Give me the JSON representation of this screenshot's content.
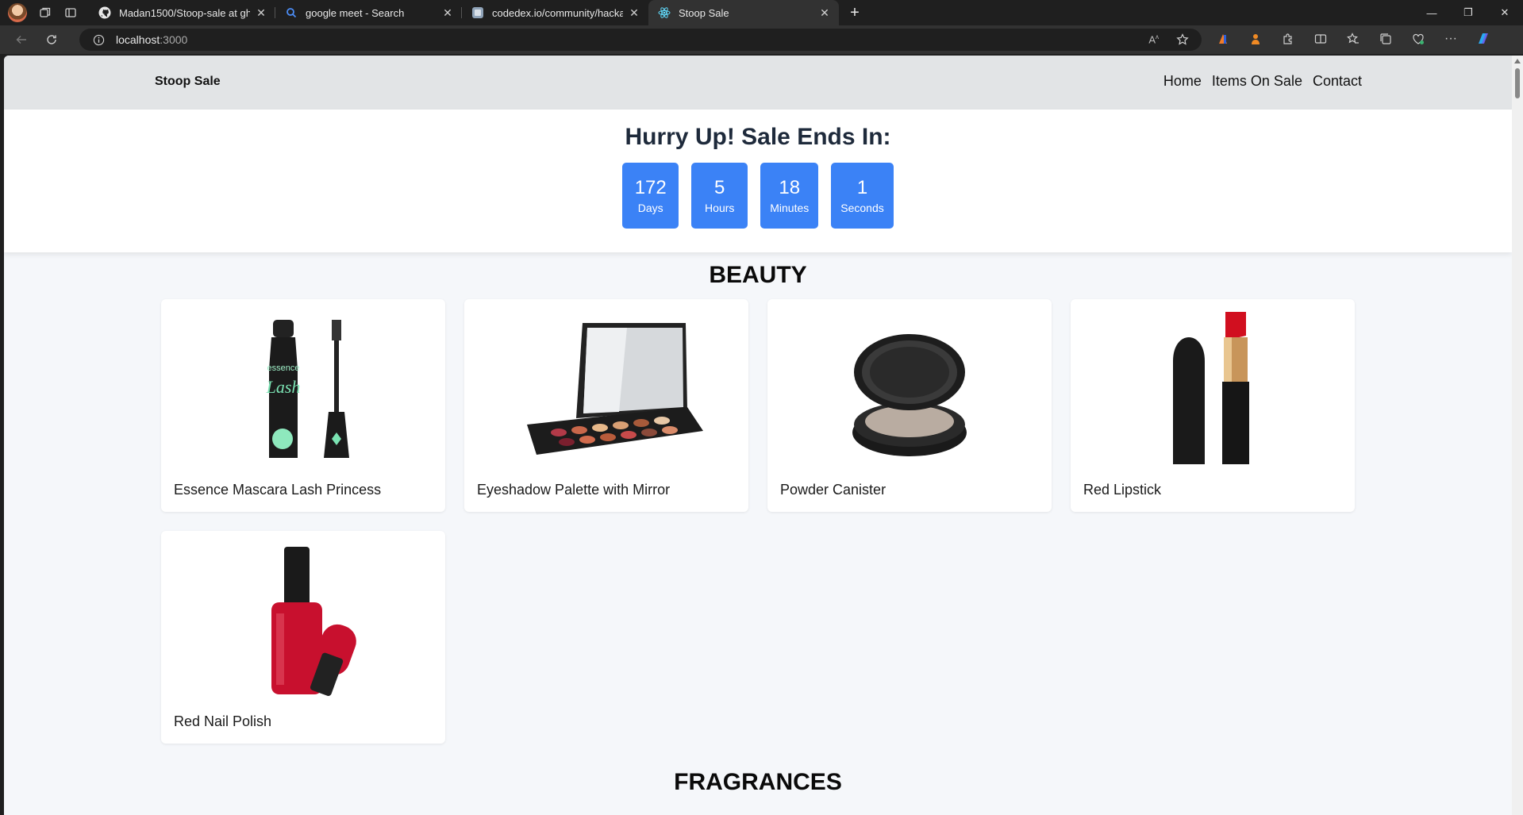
{
  "browser": {
    "tabs": [
      {
        "title": "Madan1500/Stoop-sale at gh-pa",
        "icon": "github-icon"
      },
      {
        "title": "google meet - Search",
        "icon": "search-icon"
      },
      {
        "title": "codedex.io/community/hackatho",
        "icon": "codedex-icon"
      },
      {
        "title": "Stoop Sale",
        "icon": "react-icon",
        "active": true
      }
    ],
    "address": {
      "host": "localhost",
      "port": ":3000"
    }
  },
  "site": {
    "brand": "Stoop Sale",
    "nav": [
      "Home",
      "Items On Sale",
      "Contact"
    ]
  },
  "countdown": {
    "heading": "Hurry Up! Sale Ends In:",
    "units": [
      {
        "value": "172",
        "label": "Days"
      },
      {
        "value": "5",
        "label": "Hours"
      },
      {
        "value": "18",
        "label": "Minutes"
      },
      {
        "value": "1",
        "label": "Seconds"
      }
    ]
  },
  "sections": [
    {
      "title": "BEAUTY",
      "items": [
        {
          "name": "Essence Mascara Lash Princess"
        },
        {
          "name": "Eyeshadow Palette with Mirror"
        },
        {
          "name": "Powder Canister"
        },
        {
          "name": "Red Lipstick"
        },
        {
          "name": "Red Nail Polish"
        }
      ]
    },
    {
      "title": "FRAGRANCES",
      "items": []
    }
  ],
  "colors": {
    "accent": "#3b82f6",
    "header_bg": "#e2e4e6",
    "page_bg": "#f5f7fa"
  }
}
